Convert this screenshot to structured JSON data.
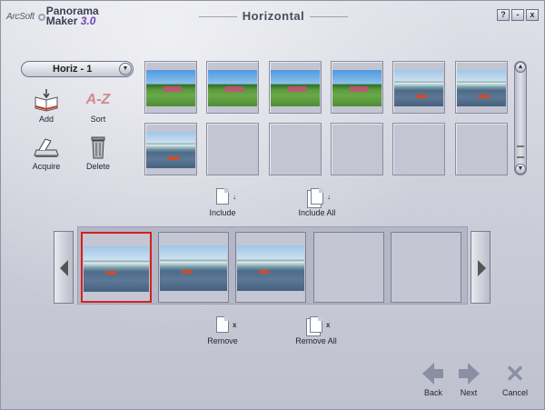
{
  "app": {
    "brand": "ArcSoft",
    "product_line1": "Panorama",
    "product_line2": "Maker",
    "version": "3.0",
    "title": "Horizontal"
  },
  "window_buttons": {
    "help": "?",
    "minimize": "-",
    "close": "x"
  },
  "dropdown": {
    "selected": "Horiz - 1",
    "arrow": "▼"
  },
  "tools": {
    "add": "Add",
    "sort": "Sort",
    "sort_glyph": "A-Z",
    "acquire": "Acquire",
    "delete": "Delete"
  },
  "library": {
    "thumbnails": [
      {
        "image": "park"
      },
      {
        "image": "park"
      },
      {
        "image": "park"
      },
      {
        "image": "park"
      },
      {
        "image": "city"
      },
      {
        "image": "city"
      },
      {
        "image": "city"
      },
      {
        "image": ""
      },
      {
        "image": ""
      },
      {
        "image": ""
      },
      {
        "image": ""
      },
      {
        "image": ""
      }
    ]
  },
  "scrollbar": {
    "up": "▲",
    "down": "▼"
  },
  "actions": {
    "include": "Include",
    "include_all": "Include All",
    "remove": "Remove",
    "remove_all": "Remove All",
    "include_mark": "↓",
    "remove_mark": "x"
  },
  "filmstrip": {
    "slots": [
      {
        "image": "city",
        "selected": true
      },
      {
        "image": "city",
        "selected": false
      },
      {
        "image": "city",
        "selected": false
      },
      {
        "image": "",
        "selected": false
      },
      {
        "image": "",
        "selected": false
      }
    ]
  },
  "footer": {
    "back": "Back",
    "next": "Next",
    "cancel": "Cancel"
  },
  "colors": {
    "selection_border": "#d42020",
    "accent_version": "#6a48b8"
  }
}
